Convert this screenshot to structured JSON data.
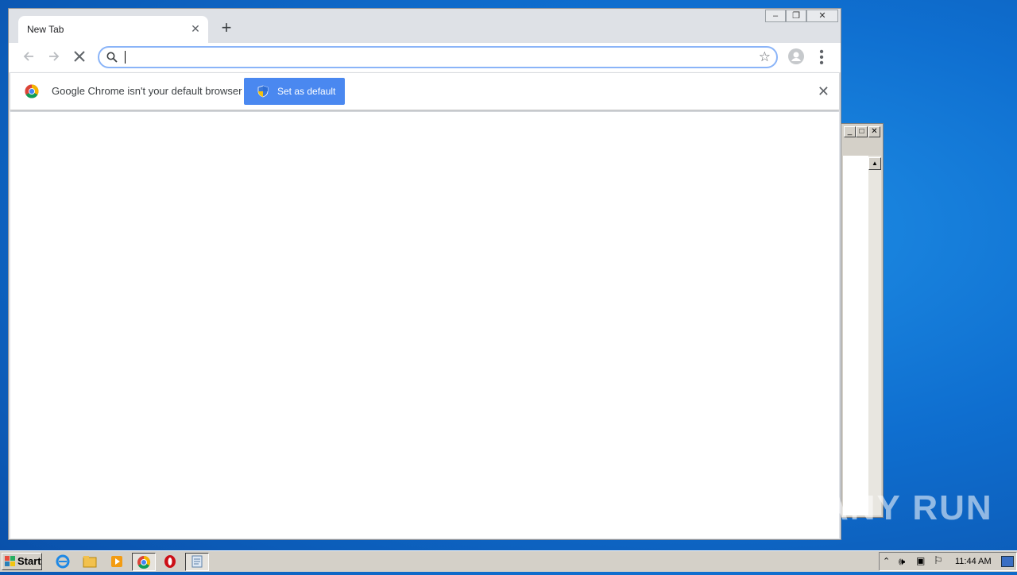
{
  "browser": {
    "tab_title": "New Tab",
    "omnibox_value": "",
    "infobar_message": "Google Chrome isn't your default browser",
    "set_default_label": "Set as default"
  },
  "watermark": {
    "text": "ANY RUN"
  },
  "taskbar": {
    "start_label": "Start",
    "clock": "11:44 AM"
  },
  "colors": {
    "accent": "#4a88f0",
    "omnibox_focus": "#8ab4f8"
  }
}
